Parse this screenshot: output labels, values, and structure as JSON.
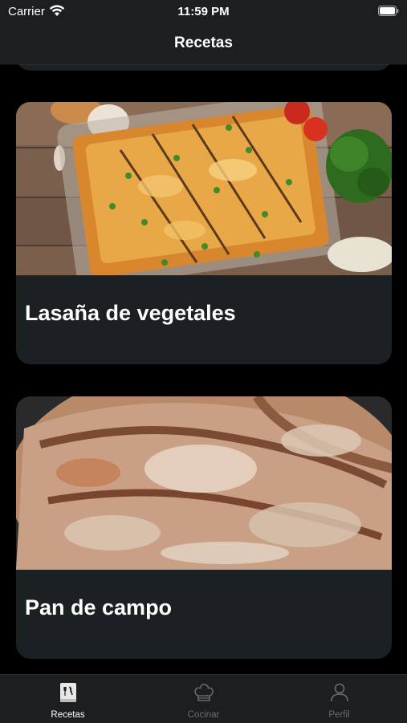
{
  "status": {
    "carrier": "Carrier",
    "time": "11:59 PM"
  },
  "nav": {
    "title": "Recetas"
  },
  "recipes": [
    {
      "title": "Lasaña de vegetales",
      "image": "vegetable-lasagna-photo"
    },
    {
      "title": "Pan de campo",
      "image": "country-bread-photo"
    }
  ],
  "tabs": [
    {
      "label": "Recetas",
      "icon": "recipe-book-icon",
      "active": true
    },
    {
      "label": "Cocinar",
      "icon": "chef-hat-icon",
      "active": false
    },
    {
      "label": "Perfil",
      "icon": "person-icon",
      "active": false
    }
  ]
}
